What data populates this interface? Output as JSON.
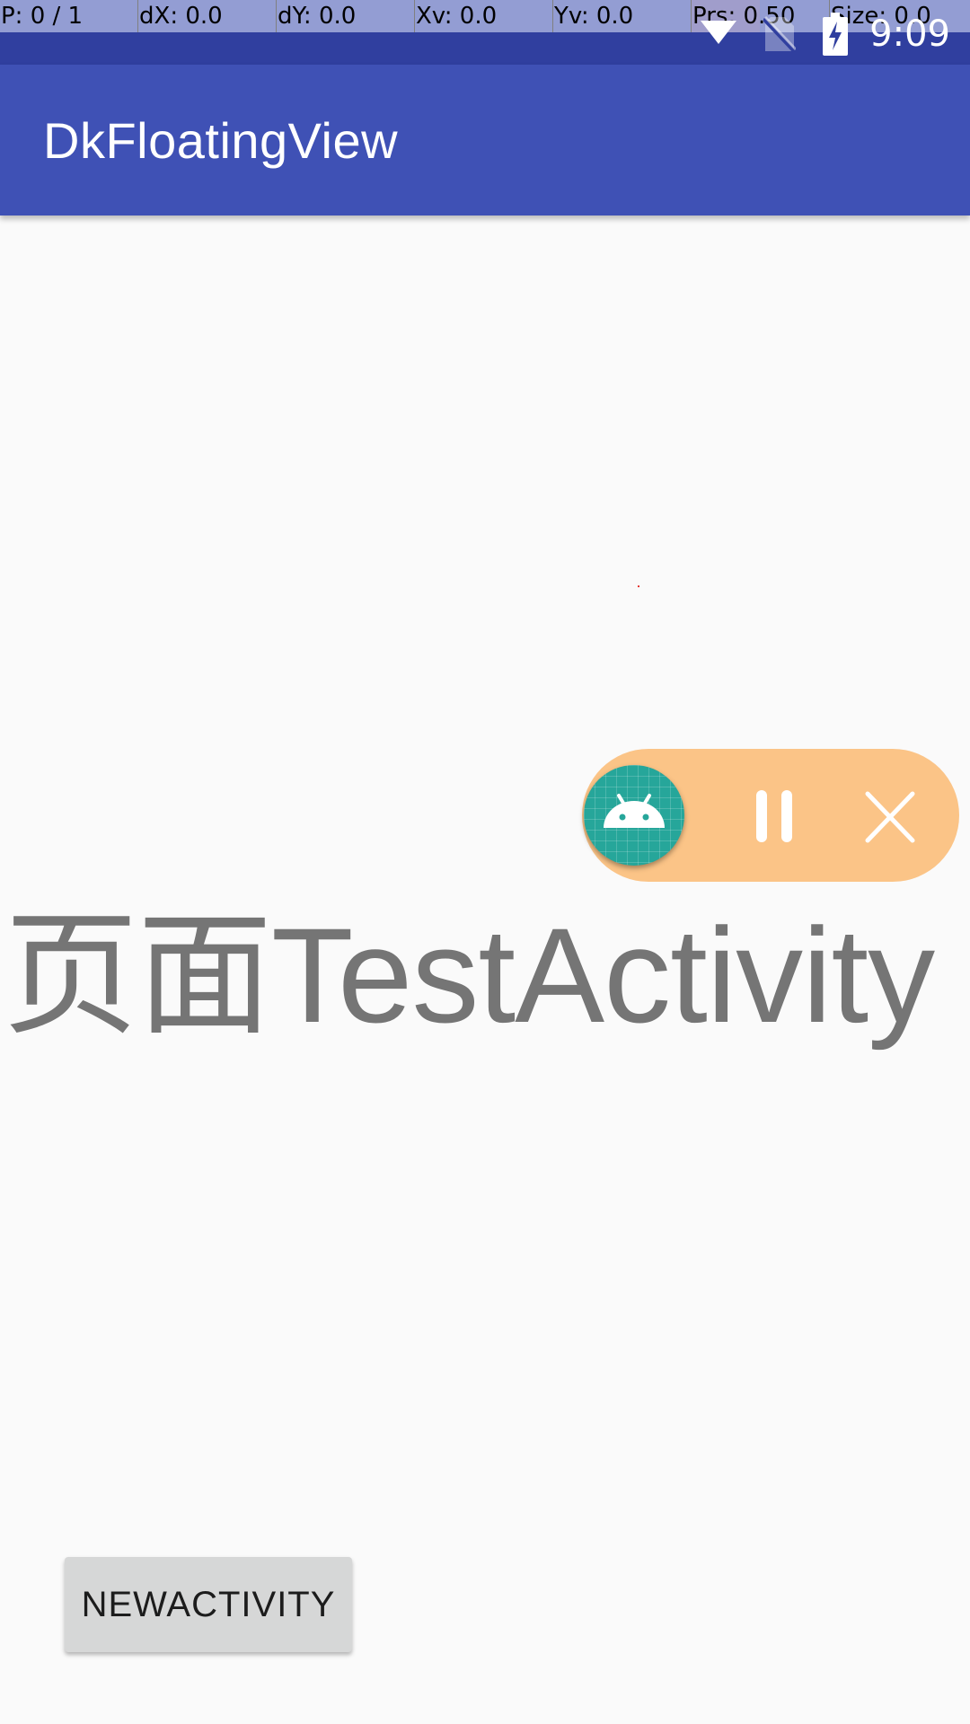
{
  "pointer_location": {
    "cells": [
      {
        "label": "P: 0 / 1"
      },
      {
        "label": "dX: 0.0"
      },
      {
        "label": "dY: 0.0"
      },
      {
        "label": "Xv: 0.0"
      },
      {
        "label": "Yv: 0.0"
      },
      {
        "label": "Prs: 0.50",
        "highlight": true
      },
      {
        "label": "Size: 0.0"
      }
    ],
    "highlight_color": "#e53935"
  },
  "status_bar": {
    "time": "9:09",
    "icons": [
      "wifi-icon",
      "no-sim-icon",
      "battery-charging-icon"
    ],
    "color": "#303f9f"
  },
  "app_bar": {
    "title": "DkFloatingView",
    "color": "#3f51b5"
  },
  "content": {
    "main_text": "页面TestActivity"
  },
  "floating_view": {
    "avatar_icon": "android-icon",
    "pause_icon": "pause-icon",
    "close_icon": "close-icon",
    "pill_color": "#fbc487",
    "avatar_color": "#26a69a"
  },
  "buttons": {
    "new_activity_label": "NEWACTIVITY"
  }
}
